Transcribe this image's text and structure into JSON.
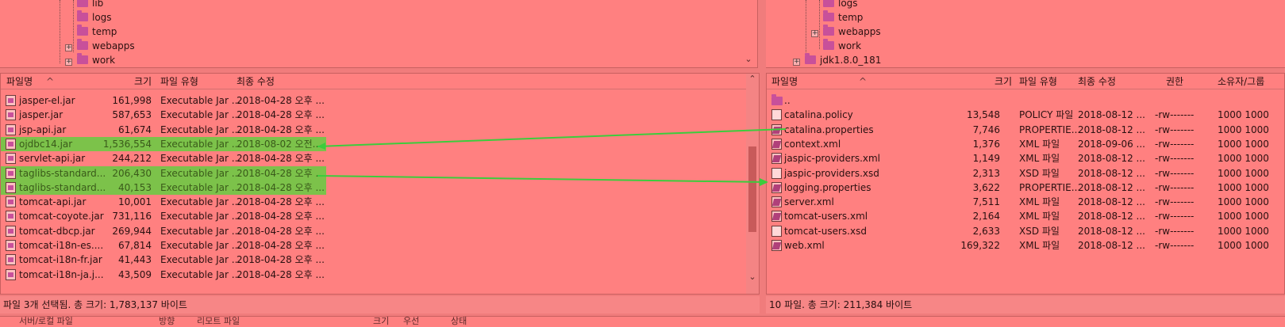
{
  "left_tree": {
    "items": [
      {
        "label": "lib",
        "expandable": false
      },
      {
        "label": "logs",
        "expandable": false
      },
      {
        "label": "temp",
        "expandable": false
      },
      {
        "label": "webapps",
        "expandable": true
      },
      {
        "label": "work",
        "expandable": true
      }
    ]
  },
  "right_tree": {
    "items": [
      {
        "label": "logs",
        "expandable": false
      },
      {
        "label": "temp",
        "expandable": false
      },
      {
        "label": "webapps",
        "expandable": true
      },
      {
        "label": "work",
        "expandable": false
      },
      {
        "label": "jdk1.8.0_181",
        "expandable": true
      }
    ]
  },
  "left_list": {
    "headers": {
      "name": "파일명",
      "size": "크기",
      "type": "파일 유형",
      "modified": "최종 수정"
    },
    "rows": [
      {
        "name": "jasper-el.jar",
        "size": "161,998",
        "type": "Executable Jar ...",
        "modified": "2018-04-28 오후 ...",
        "icon": "jar",
        "selected": false
      },
      {
        "name": "jasper.jar",
        "size": "587,653",
        "type": "Executable Jar ...",
        "modified": "2018-04-28 오후 ...",
        "icon": "jar",
        "selected": false
      },
      {
        "name": "jsp-api.jar",
        "size": "61,674",
        "type": "Executable Jar ...",
        "modified": "2018-04-28 오후 ...",
        "icon": "jar",
        "selected": false
      },
      {
        "name": "ojdbc14.jar",
        "size": "1,536,554",
        "type": "Executable Jar ...",
        "modified": "2018-08-02 오전...",
        "icon": "jar",
        "selected": true
      },
      {
        "name": "servlet-api.jar",
        "size": "244,212",
        "type": "Executable Jar ...",
        "modified": "2018-04-28 오후 ...",
        "icon": "jar",
        "selected": false
      },
      {
        "name": "taglibs-standard...",
        "size": "206,430",
        "type": "Executable Jar ...",
        "modified": "2018-04-28 오후 ...",
        "icon": "jar",
        "selected": true
      },
      {
        "name": "taglibs-standard...",
        "size": "40,153",
        "type": "Executable Jar ...",
        "modified": "2018-04-28 오후 ...",
        "icon": "jar",
        "selected": true
      },
      {
        "name": "tomcat-api.jar",
        "size": "10,001",
        "type": "Executable Jar ...",
        "modified": "2018-04-28 오후 ...",
        "icon": "jar",
        "selected": false
      },
      {
        "name": "tomcat-coyote.jar",
        "size": "731,116",
        "type": "Executable Jar ...",
        "modified": "2018-04-28 오후 ...",
        "icon": "jar",
        "selected": false
      },
      {
        "name": "tomcat-dbcp.jar",
        "size": "269,944",
        "type": "Executable Jar ...",
        "modified": "2018-04-28 오후 ...",
        "icon": "jar",
        "selected": false
      },
      {
        "name": "tomcat-i18n-es....",
        "size": "67,814",
        "type": "Executable Jar ...",
        "modified": "2018-04-28 오후 ...",
        "icon": "jar",
        "selected": false
      },
      {
        "name": "tomcat-i18n-fr.jar",
        "size": "41,443",
        "type": "Executable Jar ...",
        "modified": "2018-04-28 오후 ...",
        "icon": "jar",
        "selected": false
      },
      {
        "name": "tomcat-i18n-ja.j...",
        "size": "43,509",
        "type": "Executable Jar ...",
        "modified": "2018-04-28 오후 ...",
        "icon": "jar",
        "selected": false
      }
    ],
    "status": "파일 3개 선택됨. 총 크기: 1,783,137 바이트"
  },
  "right_list": {
    "headers": {
      "name": "파일명",
      "size": "크기",
      "type": "파일 유형",
      "modified": "최종 수정",
      "perm": "권한",
      "owner": "소유자/그룹"
    },
    "rows": [
      {
        "name": "..",
        "size": "",
        "type": "",
        "modified": "",
        "perm": "",
        "owner": "",
        "icon": "folder"
      },
      {
        "name": "catalina.policy",
        "size": "13,548",
        "type": "POLICY 파일",
        "modified": "2018-08-12 ...",
        "perm": "-rw-------",
        "owner": "1000 1000",
        "icon": "plain"
      },
      {
        "name": "catalina.properties",
        "size": "7,746",
        "type": "PROPERTIE...",
        "modified": "2018-08-12 ...",
        "perm": "-rw-------",
        "owner": "1000 1000",
        "icon": "xml"
      },
      {
        "name": "context.xml",
        "size": "1,376",
        "type": "XML 파일",
        "modified": "2018-09-06 ...",
        "perm": "-rw-------",
        "owner": "1000 1000",
        "icon": "xml"
      },
      {
        "name": "jaspic-providers.xml",
        "size": "1,149",
        "type": "XML 파일",
        "modified": "2018-08-12 ...",
        "perm": "-rw-------",
        "owner": "1000 1000",
        "icon": "xml"
      },
      {
        "name": "jaspic-providers.xsd",
        "size": "2,313",
        "type": "XSD 파일",
        "modified": "2018-08-12 ...",
        "perm": "-rw-------",
        "owner": "1000 1000",
        "icon": "plain"
      },
      {
        "name": "logging.properties",
        "size": "3,622",
        "type": "PROPERTIE...",
        "modified": "2018-08-12 ...",
        "perm": "-rw-------",
        "owner": "1000 1000",
        "icon": "xml"
      },
      {
        "name": "server.xml",
        "size": "7,511",
        "type": "XML 파일",
        "modified": "2018-08-12 ...",
        "perm": "-rw-------",
        "owner": "1000 1000",
        "icon": "xml"
      },
      {
        "name": "tomcat-users.xml",
        "size": "2,164",
        "type": "XML 파일",
        "modified": "2018-08-12 ...",
        "perm": "-rw-------",
        "owner": "1000 1000",
        "icon": "xml"
      },
      {
        "name": "tomcat-users.xsd",
        "size": "2,633",
        "type": "XSD 파일",
        "modified": "2018-08-12 ...",
        "perm": "-rw-------",
        "owner": "1000 1000",
        "icon": "plain"
      },
      {
        "name": "web.xml",
        "size": "169,322",
        "type": "XML 파일",
        "modified": "2018-08-12 ...",
        "perm": "-rw-------",
        "owner": "1000 1000",
        "icon": "xml"
      }
    ],
    "status": "10 파일. 총 크기: 211,384 바이트"
  },
  "bottom_tabs": [
    "서버/로컬 파일",
    "방향",
    "리모트 파일",
    "크기",
    "우선",
    "상태"
  ],
  "colors": {
    "background": "#ff8080",
    "selection": "#7cc24a",
    "annotation_line": "#3ccc3c"
  }
}
